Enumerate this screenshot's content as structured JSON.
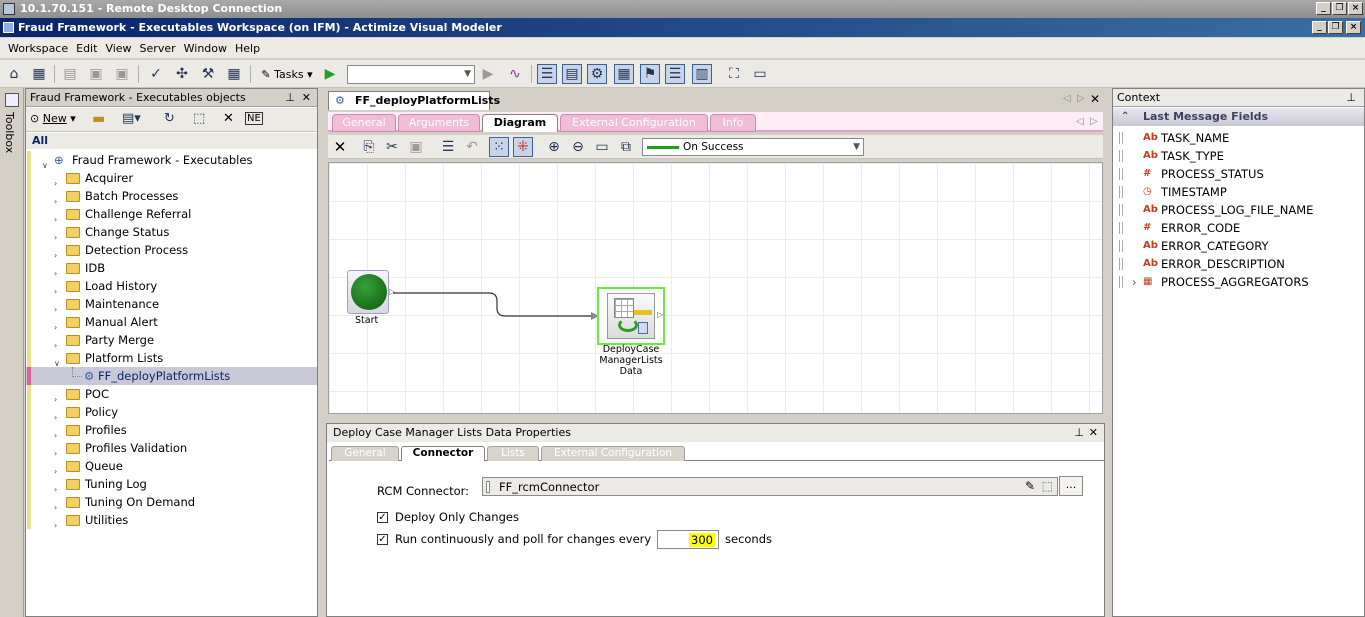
{
  "rdp_title": "10.1.70.151 - Remote Desktop Connection",
  "app_title": "Fraud Framework - Executables Workspace (on  IFM)  - Actimize Visual Modeler",
  "menu": [
    "Workspace",
    "Edit",
    "View",
    "Server",
    "Window",
    "Help"
  ],
  "toolbar": {
    "tasks_label": "Tasks"
  },
  "toolbox_label": "Toolbox",
  "left_panel": {
    "title": "Fraud Framework - Executables objects",
    "new_label": "New",
    "all_label": "All",
    "root": "Fraud Framework - Executables",
    "items": [
      "Acquirer",
      "Batch Processes",
      "Challenge Referral",
      "Change Status",
      "Detection Process",
      "IDB",
      "Load History",
      "Maintenance",
      "Manual Alert",
      "Party Merge",
      "Platform Lists",
      "FF_deployPlatformLists",
      "POC",
      "Policy",
      "Profiles",
      "Profiles Validation",
      "Queue",
      "Tuning Log",
      "Tuning On Demand",
      "Utilities"
    ]
  },
  "doc_tab": "FF_deployPlatformLists",
  "sub_tabs": [
    "General",
    "Arguments",
    "Diagram",
    "External Configuration",
    "Info"
  ],
  "connector_combo": "On Success",
  "diagram": {
    "start_label": "Start",
    "node_label_1": "DeployCase",
    "node_label_2": "ManagerLists",
    "node_label_3": "Data"
  },
  "props": {
    "title": "Deploy Case Manager Lists Data Properties",
    "tabs": [
      "General",
      "Connector",
      "Lists",
      "External Configuration"
    ],
    "rcm_label": "RCM Connector:",
    "rcm_value": "FF_rcmConnector",
    "browse": "...",
    "deploy_only": "Deploy Only Changes",
    "run_cont": "Run continuously and poll for changes every",
    "poll_value": "300",
    "seconds": "seconds"
  },
  "context": {
    "title": "Context",
    "section": "Last Message Fields",
    "fields": [
      {
        "icon": "Ab",
        "name": "TASK_NAME"
      },
      {
        "icon": "Ab",
        "name": "TASK_TYPE"
      },
      {
        "icon": "#",
        "name": "PROCESS_STATUS"
      },
      {
        "icon": "clock",
        "name": "TIMESTAMP"
      },
      {
        "icon": "Ab",
        "name": "PROCESS_LOG_FILE_NAME"
      },
      {
        "icon": "#",
        "name": "ERROR_CODE"
      },
      {
        "icon": "Ab",
        "name": "ERROR_CATEGORY"
      },
      {
        "icon": "Ab",
        "name": "ERROR_DESCRIPTION"
      },
      {
        "icon": "grid",
        "name": "PROCESS_AGGREGATORS"
      }
    ]
  },
  "colors": {
    "accent_tab": "#f0bcd8",
    "highlight": "#ffff00",
    "start_green": "#1a7a1a"
  }
}
